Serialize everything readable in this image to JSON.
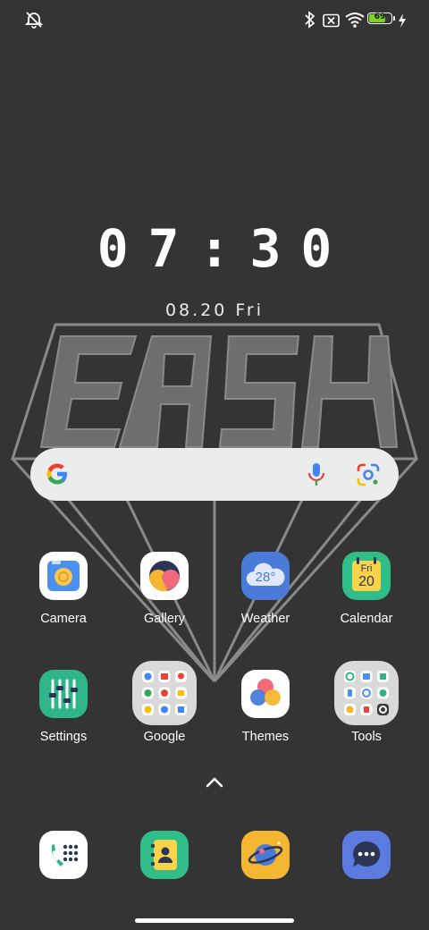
{
  "status_bar": {
    "left_icon": "alarm-off-icon",
    "right_icons": [
      "bluetooth-icon",
      "no-sim-icon",
      "wifi-icon",
      "battery-icon",
      "charging-bolt-icon"
    ],
    "battery_level": "69"
  },
  "clock": {
    "time": "07:30",
    "date": "08.20 Fri"
  },
  "wallpaper": {
    "text": "EASY"
  },
  "search": {
    "icons": [
      "google-g-icon",
      "microphone-icon",
      "lens-camera-icon"
    ]
  },
  "apps": [
    {
      "label": "Camera",
      "icon": "camera-app-icon"
    },
    {
      "label": "Gallery",
      "icon": "gallery-app-icon"
    },
    {
      "label": "Weather",
      "icon": "weather-app-icon",
      "badge": "28°"
    },
    {
      "label": "Calendar",
      "icon": "calendar-app-icon",
      "day": "Fri",
      "date": "20"
    },
    {
      "label": "Settings",
      "icon": "settings-app-icon"
    },
    {
      "label": "Google",
      "icon": "google-folder-icon"
    },
    {
      "label": "Themes",
      "icon": "themes-app-icon"
    },
    {
      "label": "Tools",
      "icon": "tools-folder-icon"
    }
  ],
  "app_drawer_icon": "chevron-up-icon",
  "dock": [
    "phone-app-icon",
    "contacts-app-icon",
    "browser-app-icon",
    "messages-app-icon"
  ],
  "colors": {
    "background": "#343434",
    "battery": "#7ed321",
    "camera_bg": "#4a90f0",
    "weather_bg": "#4a7bd8",
    "calendar_bg": "#2fbd8a",
    "settings_bg": "#2fb58a",
    "messages_bg": "#5b7be0"
  }
}
